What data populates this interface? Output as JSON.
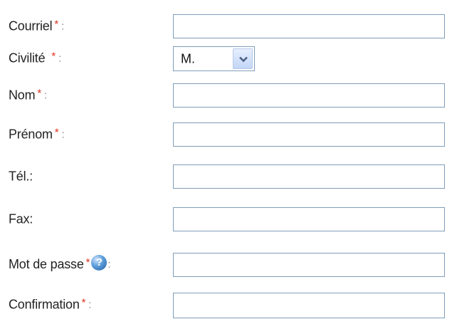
{
  "form": {
    "fields": [
      {
        "label": "Courriel",
        "required": "*",
        "colon": ":",
        "value": ""
      },
      {
        "label": "Civilité",
        "required": "*",
        "colon": ":",
        "value": "M."
      },
      {
        "label": "Nom",
        "required": "*",
        "colon": ":",
        "value": ""
      },
      {
        "label": "Prénom",
        "required": "*",
        "colon": ":",
        "value": ""
      },
      {
        "label": "Tél.",
        "colon": ":",
        "value": ""
      },
      {
        "label": "Fax",
        "colon": ":",
        "value": ""
      },
      {
        "label": "Mot de passe",
        "required": "*",
        "colon": ":",
        "value": "",
        "help_icon": "help-icon",
        "help_glyph": "?"
      },
      {
        "label": "Confirmation",
        "required": "*",
        "colon": ":",
        "value": ""
      }
    ]
  },
  "colors": {
    "required_marker": "#e0301e",
    "field_border": "#7f9db9",
    "help_icon": "#3f80c6"
  }
}
